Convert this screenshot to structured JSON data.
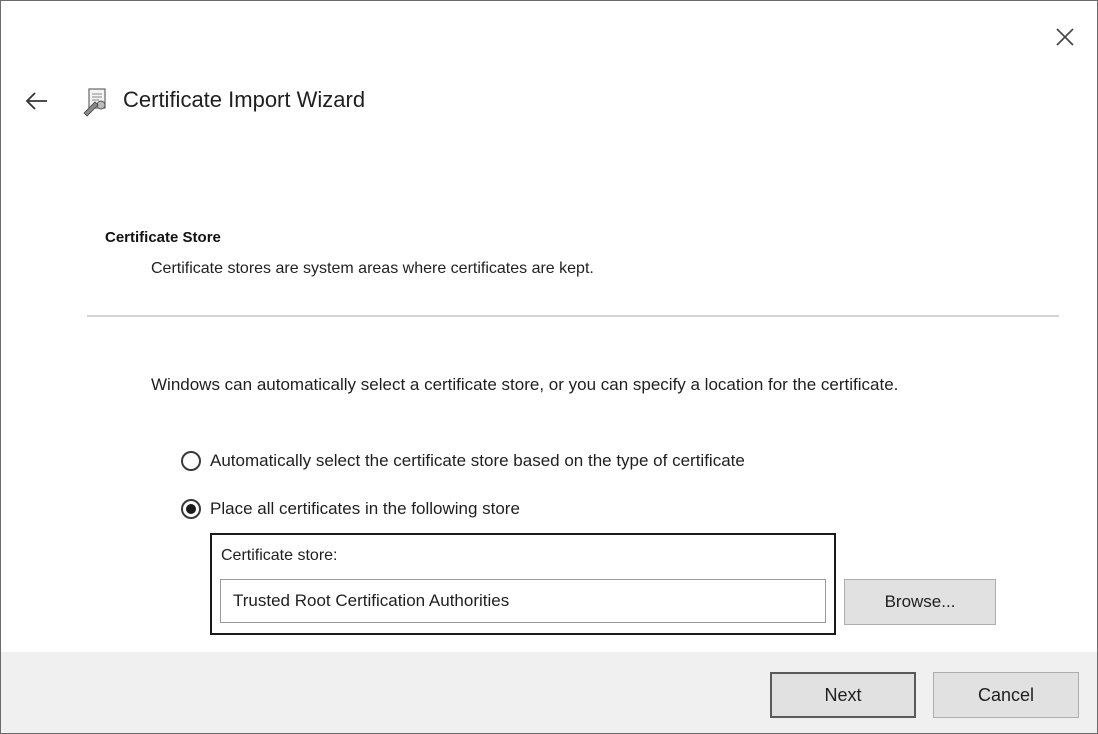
{
  "window": {
    "title": "Certificate Import Wizard",
    "icons": {
      "close": "close-icon",
      "back": "back-arrow-icon",
      "wizard": "certificate-wizard-icon"
    }
  },
  "page": {
    "heading": "Certificate Store",
    "subtitle": "Certificate stores are system areas where certificates are kept.",
    "description": "Windows can automatically select a certificate store, or you can specify a location for the certificate."
  },
  "options": [
    {
      "label": "Automatically select the certificate store based on the type of certificate",
      "selected": false
    },
    {
      "label": "Place all certificates in the following store",
      "selected": true
    }
  ],
  "store": {
    "label": "Certificate store:",
    "value": "Trusted Root Certification Authorities",
    "browse_label": "Browse..."
  },
  "footer": {
    "next_label": "Next",
    "cancel_label": "Cancel"
  },
  "colors": {
    "footer_background": "#f0f0f0",
    "button_face": "#e1e1e1",
    "highlight_border": "#1a1a1a"
  }
}
